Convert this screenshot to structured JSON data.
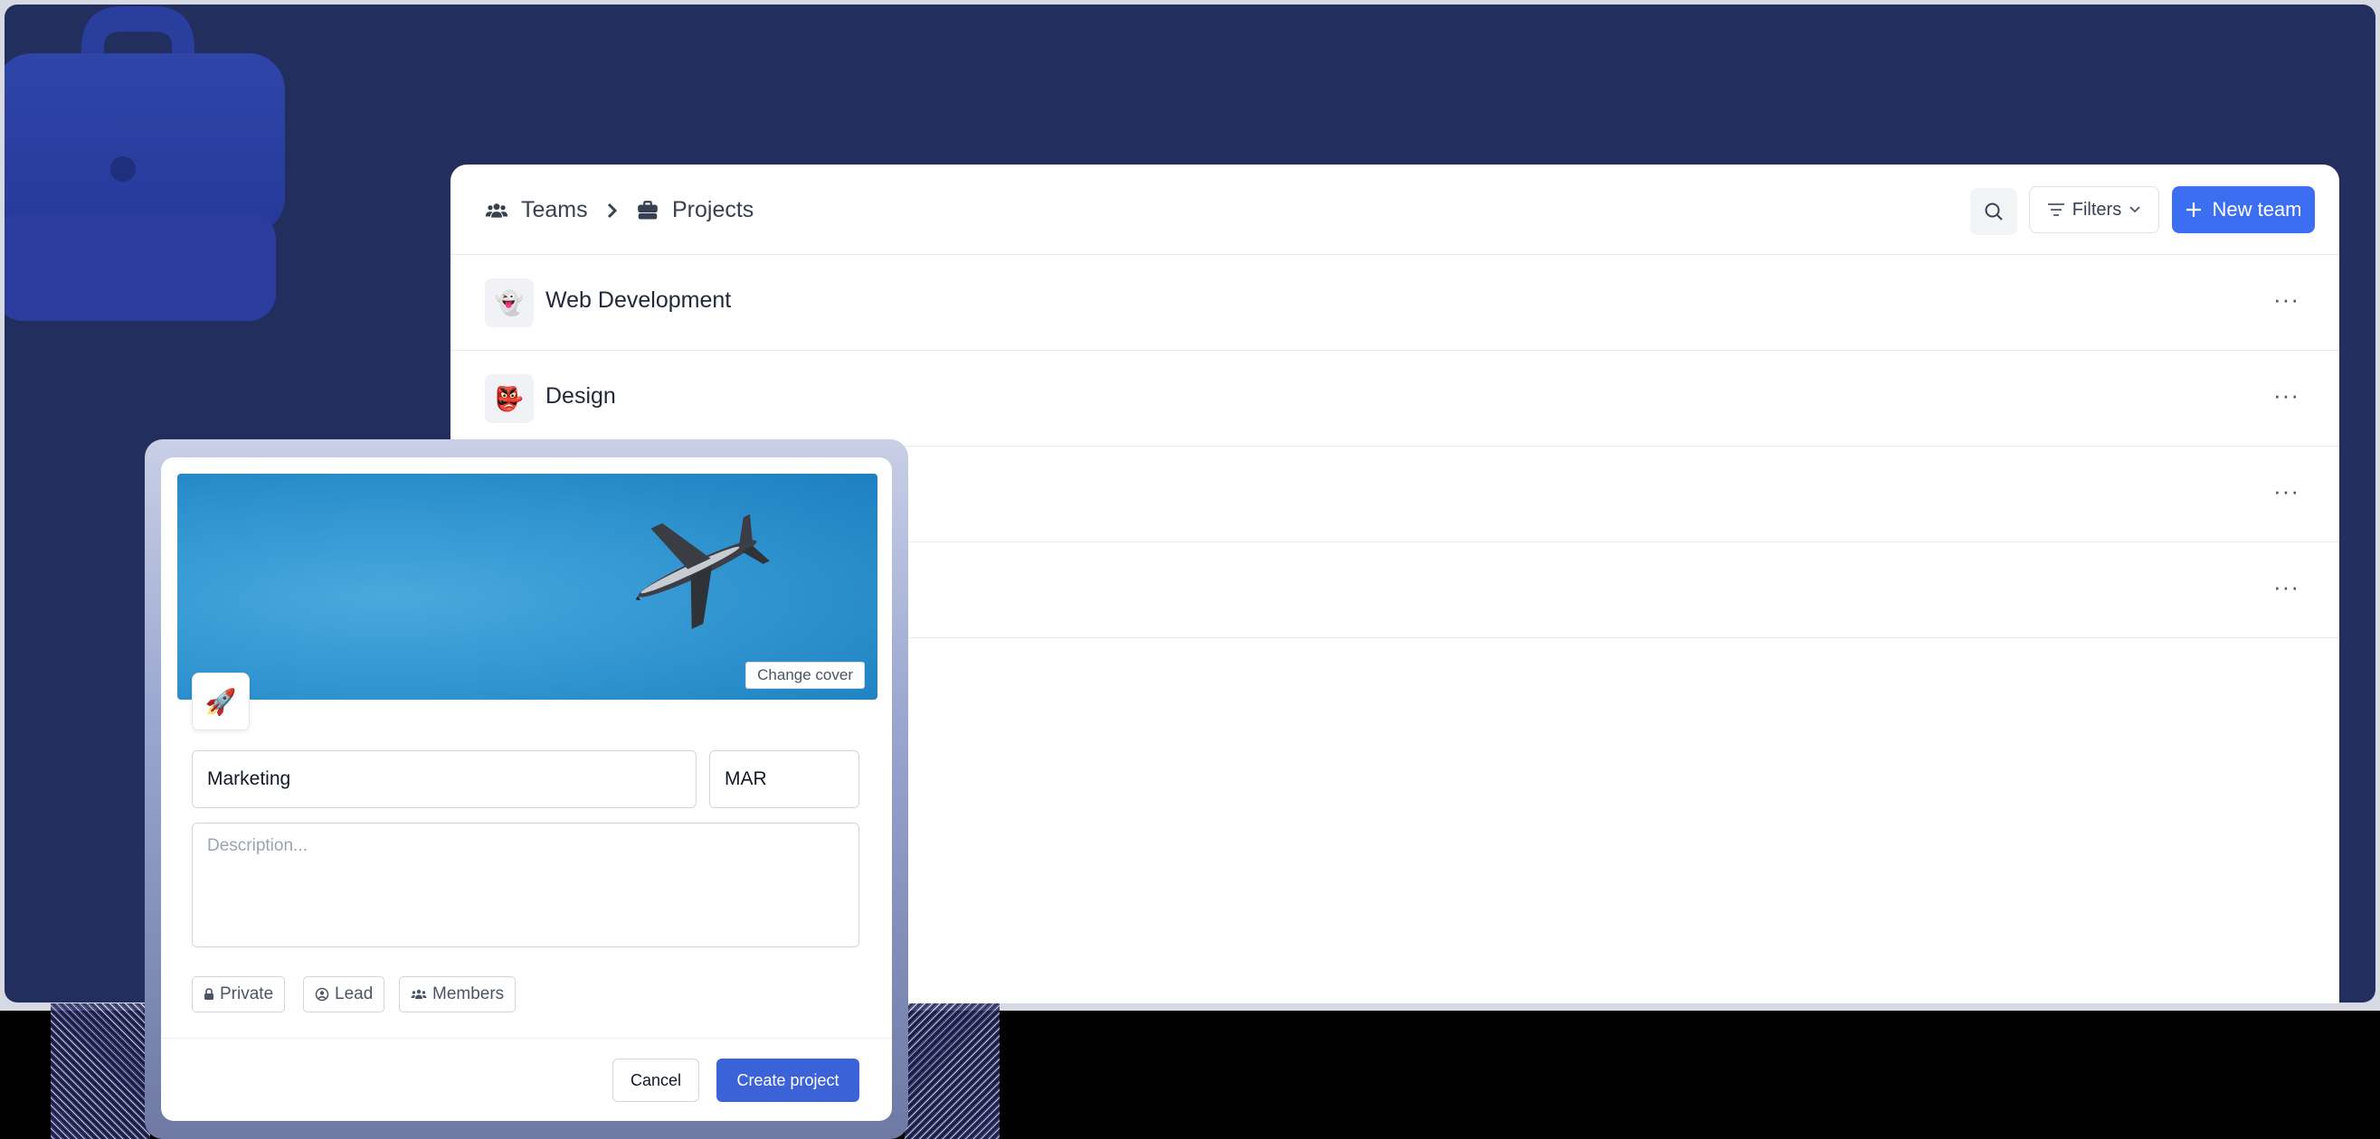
{
  "header": {
    "breadcrumb": [
      {
        "label": "Teams",
        "icon": "users-icon"
      },
      {
        "label": "Projects",
        "icon": "briefcase-icon"
      }
    ],
    "filters_label": "Filters",
    "new_team_label": "New team"
  },
  "teams": [
    {
      "name": "Web Development",
      "emoji": "👻"
    },
    {
      "name": "Design",
      "emoji": "👺"
    },
    {
      "name": "",
      "emoji": ""
    },
    {
      "name": "",
      "emoji": ""
    }
  ],
  "modal": {
    "change_cover_label": "Change cover",
    "icon_emoji": "🚀",
    "name_value": "Marketing",
    "key_value": "MAR",
    "description_placeholder": "Description...",
    "chips": [
      "Private",
      "Lead",
      "Members"
    ],
    "cancel_label": "Cancel",
    "create_label": "Create project"
  },
  "colors": {
    "backdrop": "#212e5e",
    "primary": "#3b6ef0",
    "create_button": "#3c62d8",
    "cover_sky": "#2f93cf"
  }
}
